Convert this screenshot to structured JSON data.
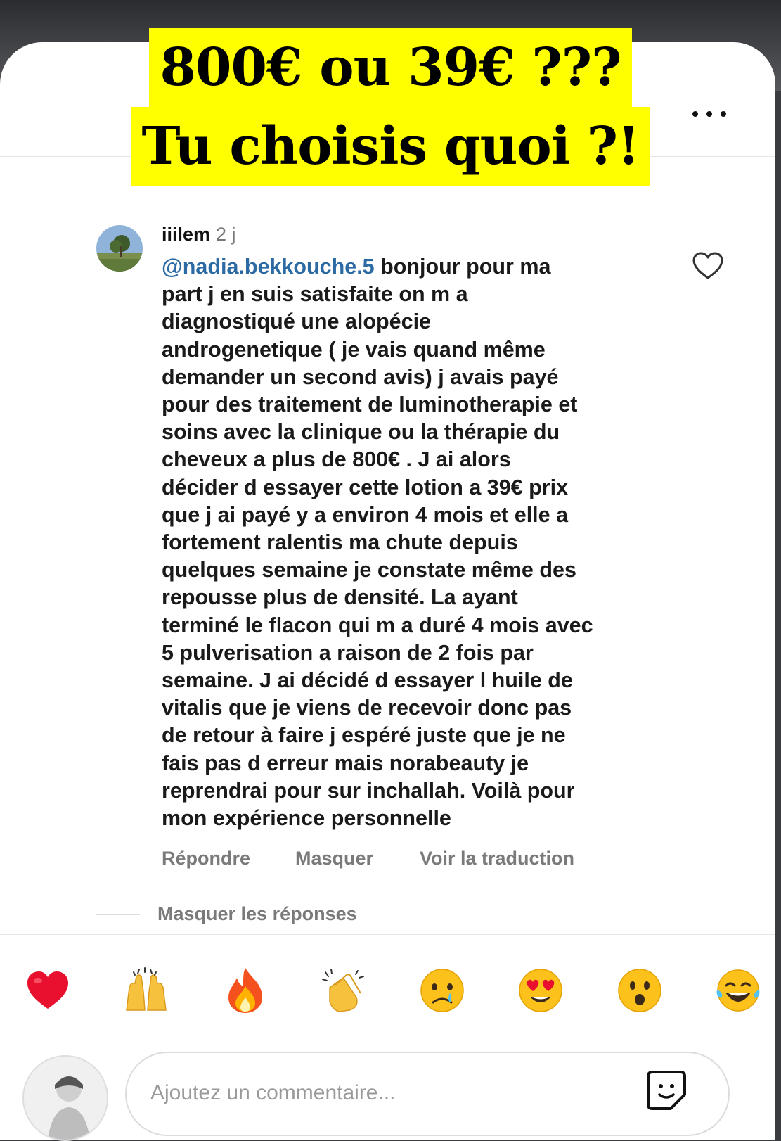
{
  "banner": {
    "line1": "800€ ou 39€ ???",
    "line2": "Tu choisis quoi ?!"
  },
  "header": {
    "more_icon": "more-horizontal-icon"
  },
  "comment": {
    "username": "iiilem",
    "time": "2 j",
    "mention": "@nadia.bekkouche.5",
    "lines": [
      " bonjour pour ma",
      "part j en suis satisfaite on m a",
      "diagnostiqué une alopécie",
      "androgenetique ( je vais quand même",
      "demander un second avis) j avais payé",
      "pour des traitement de luminotherapie et",
      "soins avec la clinique ou la thérapie  du",
      "cheveux a plus de 800€ . J ai alors",
      "décider d essayer  cette lotion a 39€ prix",
      "que j ai payé y a environ 4 mois et elle a",
      "fortement ralentis ma chute depuis",
      "quelques semaine je constate même des",
      "repousse plus de densité. La ayant",
      "terminé le flacon qui m a duré 4 mois avec",
      "5 pulverisation a raison de 2 fois par",
      "semaine. J ai décidé d essayer l huile de",
      "vitalis que je viens de recevoir donc pas",
      "de retour à faire j espéré juste que je ne",
      "fais pas d erreur mais norabeauty je",
      "reprendrai pour sur inchallah. Voilà pour",
      "mon expérience personnelle"
    ],
    "actions": {
      "reply": "Répondre",
      "hide": "Masquer",
      "translate": "Voir la traduction"
    },
    "hide_replies": "Masquer les réponses",
    "like_icon": "heart-outline-icon"
  },
  "reactions": [
    "red-heart-emoji",
    "raising-hands-emoji",
    "fire-emoji",
    "clapping-hands-emoji",
    "crying-face-emoji",
    "heart-eyes-emoji",
    "surprised-face-emoji",
    "tears-of-joy-emoji"
  ],
  "composer": {
    "placeholder": "Ajoutez un commentaire...",
    "sticker_icon": "sticker-icon"
  },
  "colors": {
    "banner_bg": "#ffff00",
    "mention": "#2c6aa3",
    "muted": "#7a7a7a"
  }
}
